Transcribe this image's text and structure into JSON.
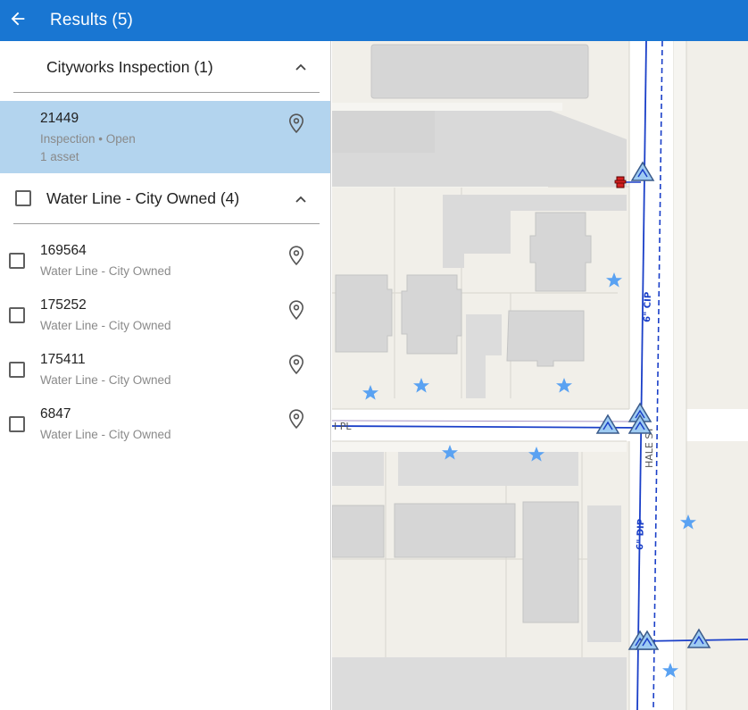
{
  "topbar": {
    "title": "Results (5)",
    "back_icon": "arrow-left-icon"
  },
  "groups": [
    {
      "title": "Cityworks Inspection (1)",
      "items": [
        {
          "id": "21449",
          "subtitle": "Inspection • Open",
          "subtitle2": "1 asset"
        }
      ]
    },
    {
      "title": "Water Line - City Owned (4)",
      "items": [
        {
          "id": "169564",
          "subtitle": "Water Line - City Owned"
        },
        {
          "id": "175252",
          "subtitle": "Water Line - City Owned"
        },
        {
          "id": "175411",
          "subtitle": "Water Line - City Owned"
        },
        {
          "id": "6847",
          "subtitle": "Water Line - City Owned"
        }
      ]
    }
  ],
  "map": {
    "street_labels": [
      "I PL",
      "HALE ST"
    ],
    "pipe_labels": [
      "6\" CIP",
      "6\" DIP"
    ],
    "colors": {
      "pipe": "#1a3fc8",
      "building": "#d6d6d6",
      "ground": "#f1efe9",
      "star": "#5aa2f2"
    }
  }
}
